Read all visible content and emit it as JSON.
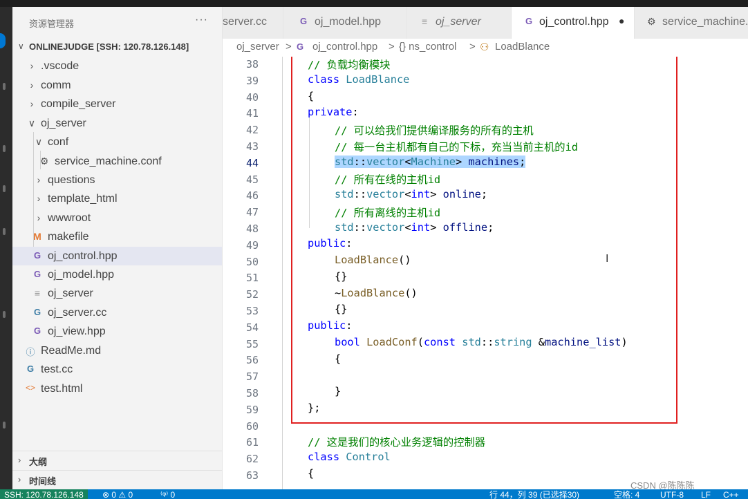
{
  "sidebar": {
    "title": "资源管理器",
    "more": "···",
    "root": "ONLINEJUDGE [SSH: 120.78.126.148]",
    "items": [
      {
        "label": ".vscode",
        "icon": "chevron-right-icon"
      },
      {
        "label": "comm",
        "icon": "chevron-right-icon"
      },
      {
        "label": "compile_server",
        "icon": "chevron-right-icon"
      },
      {
        "label": "oj_server",
        "icon": "chevron-down-icon"
      },
      {
        "label": "conf",
        "icon": "chevron-down-icon"
      },
      {
        "label": "service_machine.conf",
        "icon": "gear-icon"
      },
      {
        "label": "questions",
        "icon": "chevron-right-icon"
      },
      {
        "label": "template_html",
        "icon": "chevron-right-icon"
      },
      {
        "label": "wwwroot",
        "icon": "chevron-right-icon"
      },
      {
        "label": "makefile",
        "icon": "makefile-icon"
      },
      {
        "label": "oj_control.hpp",
        "icon": "cpp-header-icon"
      },
      {
        "label": "oj_model.hpp",
        "icon": "cpp-header-icon"
      },
      {
        "label": "oj_server",
        "icon": "plain-file-icon"
      },
      {
        "label": "oj_server.cc",
        "icon": "cpp-source-icon"
      },
      {
        "label": "oj_view.hpp",
        "icon": "cpp-header-icon"
      },
      {
        "label": "ReadMe.md",
        "icon": "info-icon"
      },
      {
        "label": "test.cc",
        "icon": "cpp-source-icon"
      },
      {
        "label": "test.html",
        "icon": "html-icon"
      }
    ],
    "outline": "大纲",
    "timeline": "时间线"
  },
  "tabs": [
    {
      "label": "server.cc",
      "icon": ""
    },
    {
      "label": "oj_model.hpp",
      "icon": "G"
    },
    {
      "label": "oj_server",
      "icon": "≡"
    },
    {
      "label": "oj_control.hpp",
      "icon": "G",
      "dirty": "●"
    },
    {
      "label": "service_machine.c",
      "icon": "⚙"
    }
  ],
  "breadcrumb": [
    "oj_server",
    ">",
    "oj_control.hpp",
    ">",
    "{} ns_control",
    ">",
    "LoadBlance"
  ],
  "editor": {
    "line_numbers": [
      "38",
      "39",
      "40",
      "41",
      "42",
      "43",
      "44",
      "45",
      "46",
      "47",
      "48",
      "49",
      "50",
      "51",
      "52",
      "53",
      "54",
      "55",
      "56",
      "57",
      "58",
      "59",
      "60",
      "61",
      "62",
      "63"
    ],
    "current_line": "44",
    "cursor_glyph": "I"
  },
  "status": {
    "remote": "SSH: 120.78.126.148",
    "problems": "⊗ 0 ⚠ 0",
    "ports": "⁽ᵠ⁾ 0",
    "position": "行 44，列 39 (已选择30)",
    "spaces": "空格: 4",
    "encoding": "UTF-8",
    "eol": "LF",
    "language": "C++"
  },
  "watermark": "CSDN @陈陈陈",
  "colors": {
    "highlight_box": "#e02020",
    "statusbar": "#007acc",
    "selection": "#add6ff"
  }
}
